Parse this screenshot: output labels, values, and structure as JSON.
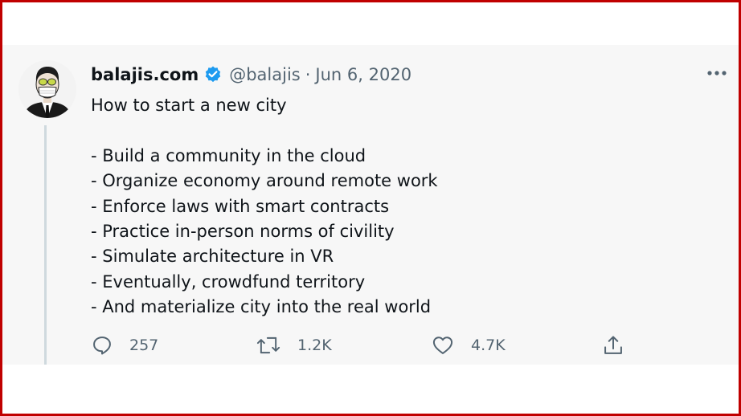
{
  "tweet": {
    "author": {
      "display_name": "balajis.com",
      "handle": "@balajis",
      "verified_icon": "verified-badge-icon",
      "avatar": "masked-man-avatar"
    },
    "separator": "·",
    "date": "Jun 6, 2020",
    "text_lines": [
      "How to start a new city",
      "",
      "- Build a community in the cloud",
      "- Organize economy around remote work",
      "- Enforce laws with smart contracts",
      "- Practice in-person norms of civility",
      "- Simulate architecture in VR",
      "- Eventually, crowdfund territory",
      "- And materialize city into the real world"
    ],
    "stats": {
      "replies": "257",
      "retweets": "1.2K",
      "likes": "4.7K"
    }
  },
  "colors": {
    "frame": "#c00000",
    "card_bg": "#f7f7f7",
    "text": "#0f1419",
    "secondary": "#536471",
    "verified": "#1d9bf0",
    "thread_line": "#cfd9de"
  }
}
